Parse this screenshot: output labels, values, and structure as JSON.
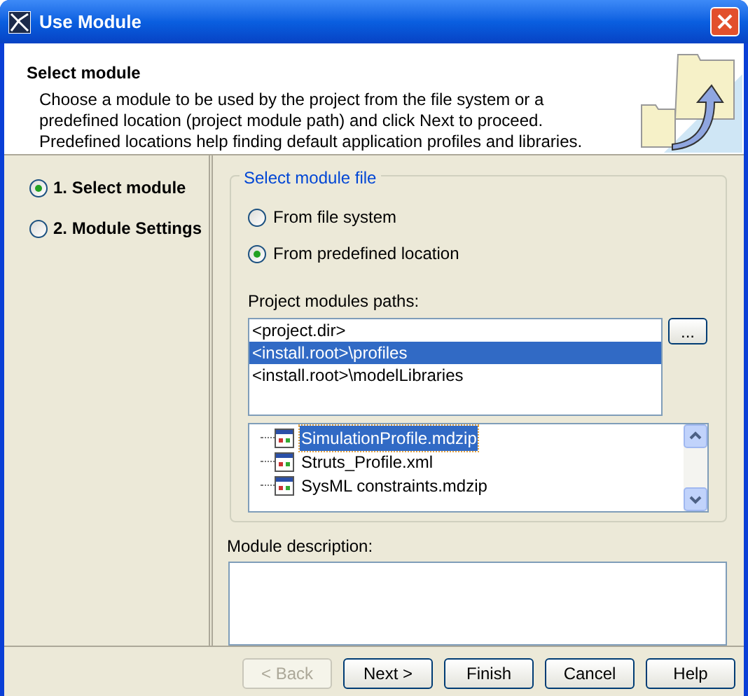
{
  "window": {
    "title": "Use Module"
  },
  "header": {
    "title": "Select module",
    "description": "Choose a module to be used by the project from the file system or a predefined location (project module path) and click Next to proceed.  Predefined locations help finding default application profiles and libraries."
  },
  "steps": [
    {
      "label": "1. Select module",
      "selected": true
    },
    {
      "label": "2. Module Settings",
      "selected": false
    }
  ],
  "module_file": {
    "legend": "Select module file",
    "options": [
      {
        "label": "From file system",
        "selected": false
      },
      {
        "label": "From predefined location",
        "selected": true
      }
    ],
    "paths_label": "Project modules paths:",
    "paths": [
      {
        "text": "<project.dir>",
        "selected": false
      },
      {
        "text": "<install.root>\\profiles",
        "selected": true
      },
      {
        "text": "<install.root>\\modelLibraries",
        "selected": false
      }
    ],
    "browse_button": "...",
    "files": [
      {
        "name": "SimulationProfile.mdzip",
        "selected": true
      },
      {
        "name": "Struts_Profile.xml",
        "selected": false
      },
      {
        "name": "SysML constraints.mdzip",
        "selected": false
      }
    ]
  },
  "description": {
    "label": "Module description:"
  },
  "buttons": [
    {
      "label": "< Back",
      "disabled": true
    },
    {
      "label": "Next >",
      "disabled": false
    },
    {
      "label": "Finish",
      "disabled": false
    },
    {
      "label": "Cancel",
      "disabled": false
    },
    {
      "label": "Help",
      "disabled": false
    }
  ]
}
